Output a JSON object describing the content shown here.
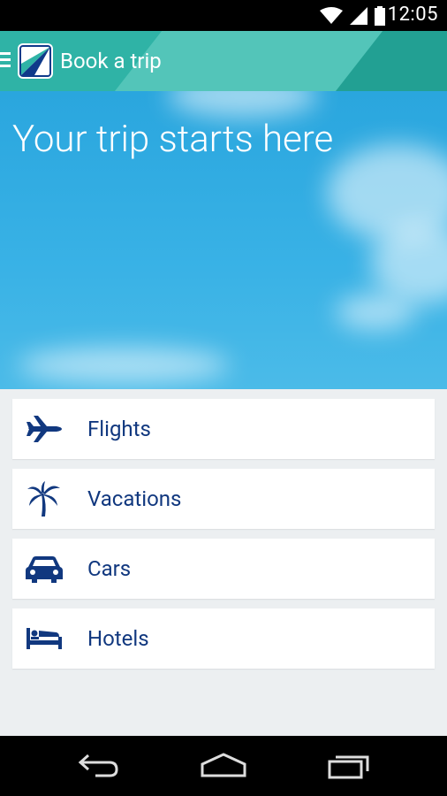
{
  "status": {
    "time": "12:05"
  },
  "appbar": {
    "title": "Book a trip"
  },
  "hero": {
    "title": "Your trip starts here"
  },
  "menu": [
    {
      "label": "Flights",
      "icon": "plane-icon"
    },
    {
      "label": "Vacations",
      "icon": "palm-tree-icon"
    },
    {
      "label": "Cars",
      "icon": "car-icon"
    },
    {
      "label": "Hotels",
      "icon": "bed-icon"
    }
  ],
  "colors": {
    "appbar": "#2fb3a6",
    "sky": "#39b2e6",
    "item_text": "#11387f",
    "background": "#eceff1"
  }
}
